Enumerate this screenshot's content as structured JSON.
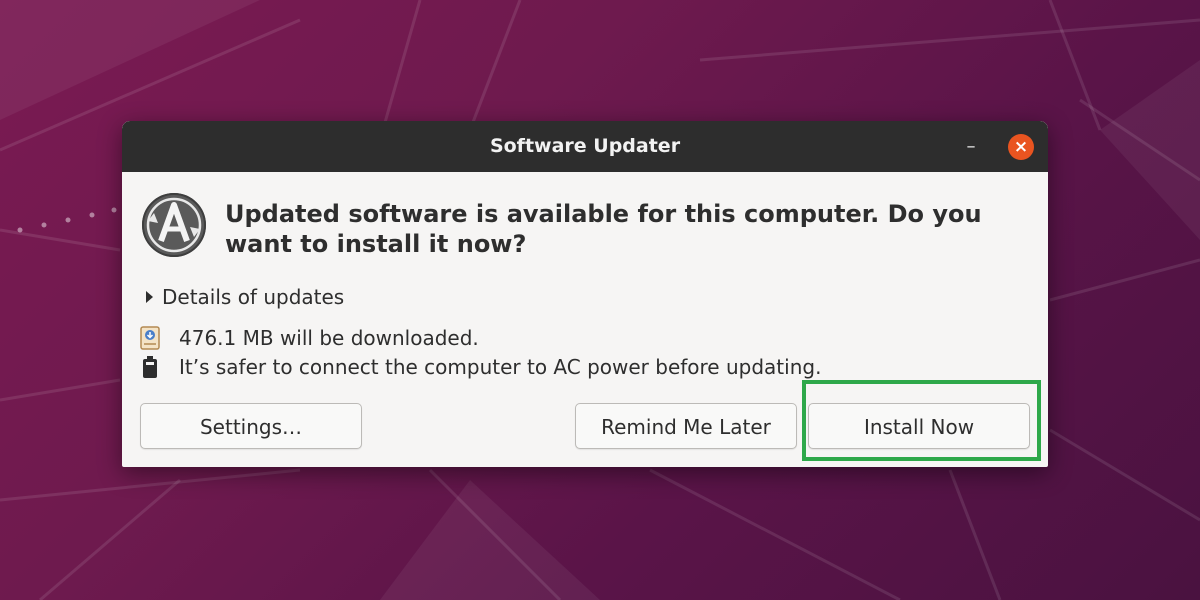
{
  "window": {
    "title": "Software Updater",
    "minimize_icon": "minimize-icon",
    "close_icon": "close-icon"
  },
  "dialog": {
    "app_icon": "software-updater-icon",
    "headline": "Updated software is available for this computer. Do you want to install it now?",
    "details_label": "Details of updates",
    "download_info": "476.1 MB will be downloaded.",
    "power_info": "It’s safer to connect the computer to AC power before updating."
  },
  "buttons": {
    "settings": "Settings…",
    "remind_later": "Remind Me Later",
    "install_now": "Install Now"
  },
  "colors": {
    "titlebar": "#2d2d2d",
    "close_button": "#e95420",
    "highlight": "#2ea84a",
    "wallpaper": "#6e1a4e"
  }
}
